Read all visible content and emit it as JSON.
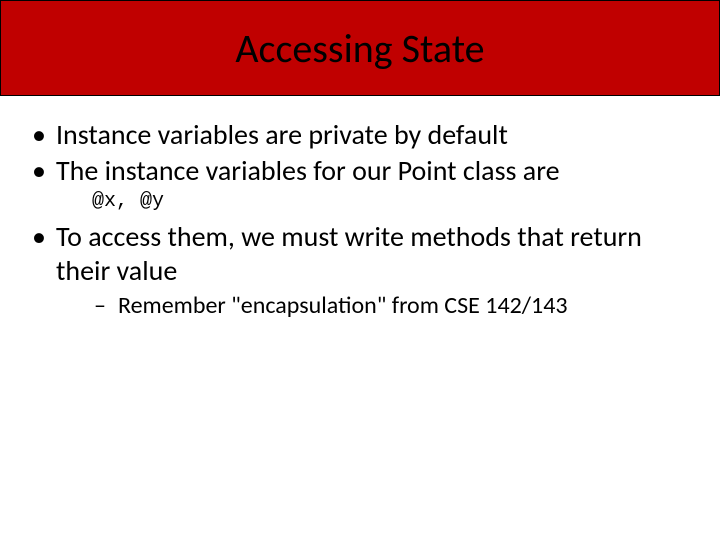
{
  "title": "Accessing State",
  "bullets": {
    "b1": "Instance variables are private by default",
    "b2": "The instance variables for our Point class are",
    "code": "@x, @y",
    "b3": "To access them, we must write methods that return their value",
    "sub1": "Remember \"encapsulation\" from CSE 142/143"
  }
}
